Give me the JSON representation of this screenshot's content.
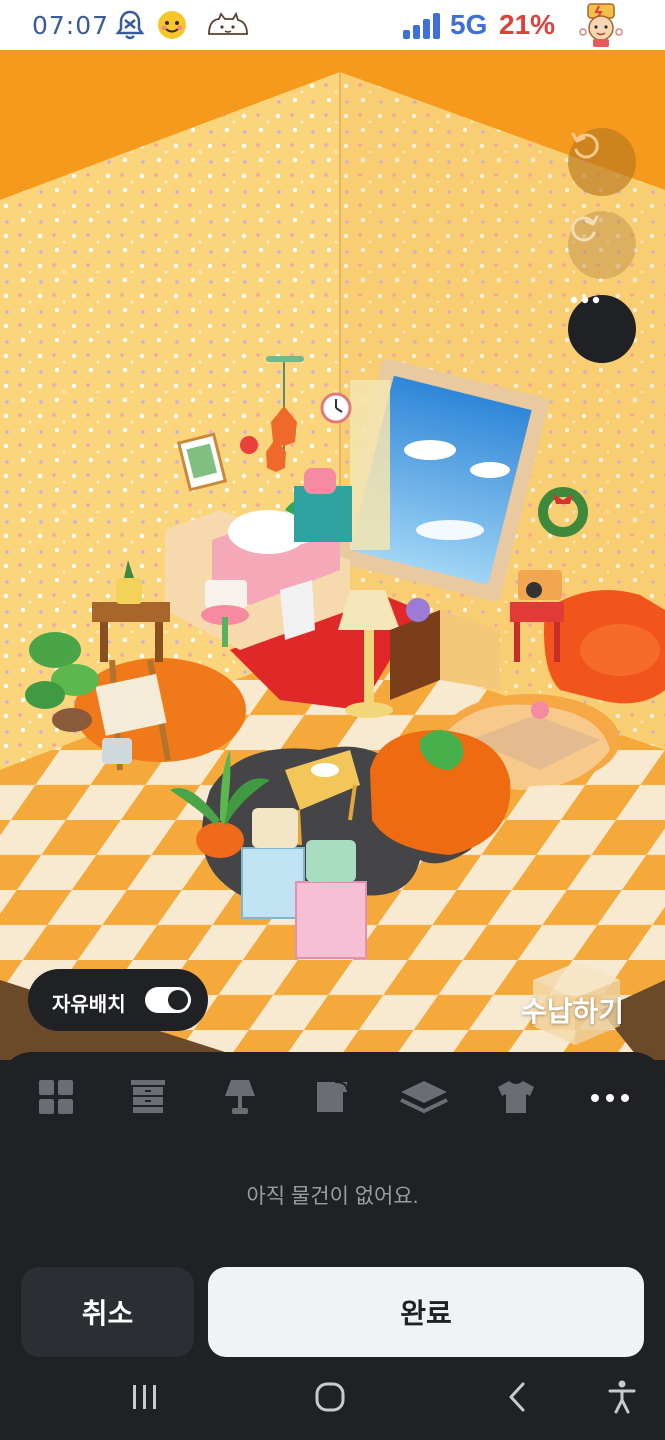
{
  "status_bar": {
    "time": "07:07",
    "network": "5G",
    "battery": "21%",
    "icons": [
      "alarm-off-icon",
      "smiley-emoji-icon",
      "cat-sticker-icon",
      "signal-icon",
      "avatar-sticker-icon"
    ]
  },
  "room": {
    "undo_icon": "undo-icon",
    "redo_icon": "redo-icon",
    "more_icon": "more-icon",
    "free_place_label": "자유배치",
    "free_place_on": true,
    "storage_label": "수납하기"
  },
  "categories": [
    {
      "icon": "grid-icon"
    },
    {
      "icon": "drawer-icon"
    },
    {
      "icon": "lamp-icon"
    },
    {
      "icon": "wallpaper-icon"
    },
    {
      "icon": "floor-layer-icon"
    },
    {
      "icon": "shirt-icon"
    },
    {
      "icon": "more-horizontal-icon"
    }
  ],
  "empty_message": "아직 물건이 없어요.",
  "actions": {
    "cancel_label": "취소",
    "done_label": "완료"
  },
  "nav": [
    "recent-apps-icon",
    "home-icon",
    "back-icon",
    "accessibility-icon"
  ],
  "colors": {
    "accent_orange": "#f69a1e",
    "panel_dark": "#1f2124",
    "done_bg": "#f1f2f4",
    "battery_red": "#e0403a",
    "network_blue": "#3f6fd8"
  }
}
